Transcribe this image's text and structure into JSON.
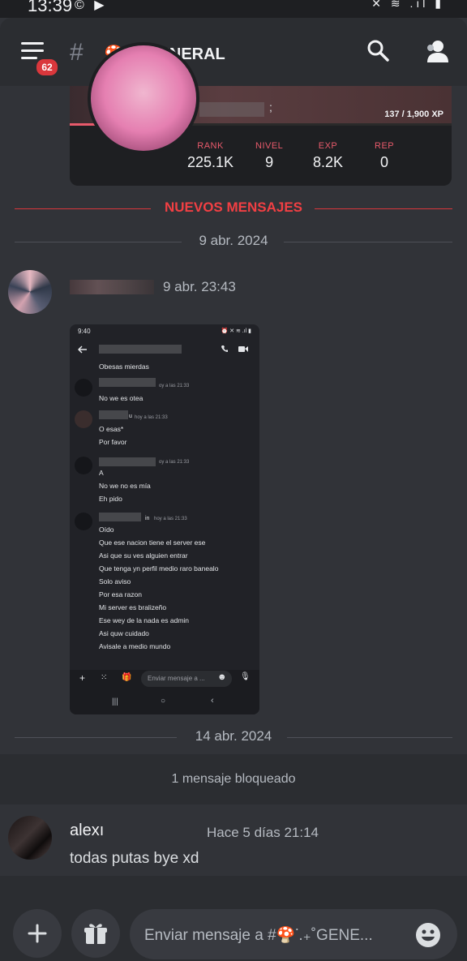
{
  "status_bar": {
    "time": "13:39",
    "left_icons": "© ▶",
    "right_icons": "✕ ≋ .ıl ▮"
  },
  "header": {
    "menu_badge": "62",
    "hash_symbol": "#",
    "channel_name": "🍄ᣟ.₊˚GENERAL"
  },
  "level_card": {
    "xp_text": "137 / 1,900 XP",
    "xp_fraction": 0.072,
    "name_suffix": ";",
    "stats": [
      {
        "label": "RANK",
        "value": "225.1K"
      },
      {
        "label": "NIVEL",
        "value": "9"
      },
      {
        "label": "EXP",
        "value": "8.2K"
      },
      {
        "label": "REP",
        "value": "0"
      }
    ]
  },
  "new_messages_divider": "NUEVOS MENSAJES",
  "date_divider_1": "9 abr. 2024",
  "message_1": {
    "timestamp": "9 abr. 23:43"
  },
  "embedded_screenshot": {
    "status_time": "9:40",
    "status_right": "⏰ ✕ ≋ .ıl ▮",
    "lines": [
      "Obesas mierdas",
      "No we es otea",
      "O esas*",
      "Por favor",
      "A",
      "No we no es mía",
      "Eh pido",
      "Oído",
      "Que ese nacion tiene el server ese",
      "Asi que su ves alguien entrar",
      "Que tenga yn perfil medio raro banealo",
      "Solo aviso",
      "Por esa razon",
      "Mi server es bralizeño",
      "Ese wey de la nada es admin",
      "Asi quw cuidado",
      "Avisale a medio mundo"
    ],
    "timestamps": [
      "oy a las 21:33",
      "hoy a las 21:33",
      "oy a las 21:33",
      "hoy a las 21:33"
    ],
    "author_suffix_1": "u",
    "author_suffix_2": "in",
    "input_placeholder": "Enviar mensaje a ..."
  },
  "date_divider_2": "14 abr. 2024",
  "blocked_text": "1 mensaje bloqueado",
  "message_2": {
    "author": "alexı",
    "timestamp": "Hace 5 días 21:14",
    "body": "todas putas bye xd"
  },
  "composer": {
    "placeholder": "Enviar mensaje a #🍄ᣟ.₊˚GENE..."
  }
}
